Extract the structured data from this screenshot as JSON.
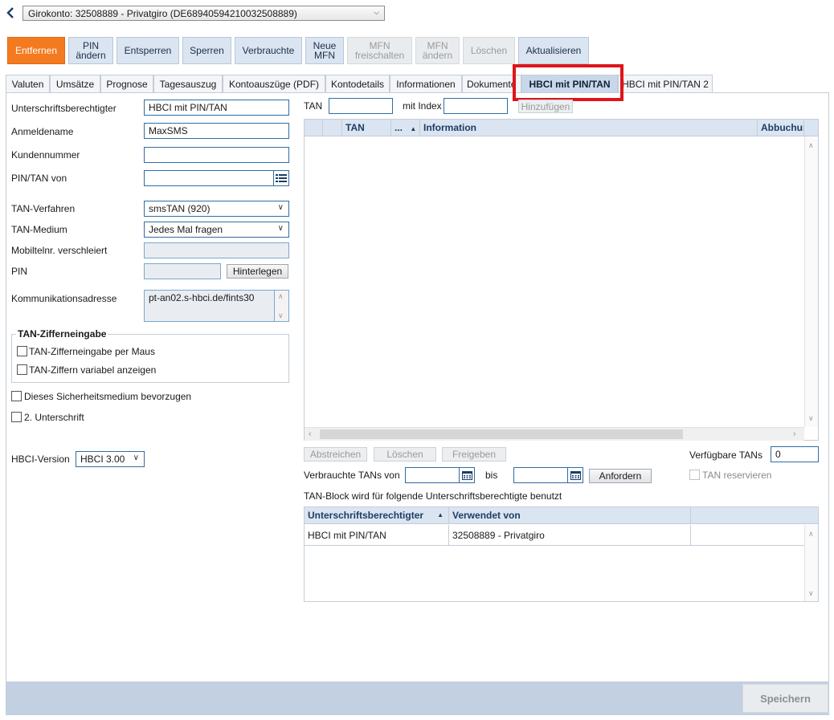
{
  "account": {
    "selector": "Girokonto: 32508889 - Privatgiro (DE68940594210032508889)"
  },
  "toolbar": {
    "remove": "Entfernen",
    "pin_change_1": "PIN",
    "pin_change_2": "ändern",
    "unlock": "Entsperren",
    "lock": "Sperren",
    "used": "Verbrauchte",
    "new_mfn_1": "Neue",
    "new_mfn_2": "MFN",
    "mfn_unlock_1": "MFN",
    "mfn_unlock_2": "freischalten",
    "mfn_change_1": "MFN",
    "mfn_change_2": "ändern",
    "delete": "Löschen",
    "refresh": "Aktualisieren"
  },
  "tabs": [
    "Valuten",
    "Umsätze",
    "Prognose",
    "Tagesauszug",
    "Kontoauszüge (PDF)",
    "Kontodetails",
    "Informationen",
    "Dokumente",
    "HBCI mit PIN/TAN",
    "HBCI mit PIN/TAN 2"
  ],
  "form": {
    "signatory_label": "Unterschriftsberechtigter",
    "signatory_value": "HBCI mit PIN/TAN",
    "login_label": "Anmeldename",
    "login_value": "MaxSMS",
    "customer_label": "Kundennummer",
    "customer_value": "",
    "pintan_from_label": "PIN/TAN von",
    "pintan_from_value": "",
    "tan_method_label": "TAN-Verfahren",
    "tan_method_value": "smsTAN (920)",
    "tan_medium_label": "TAN-Medium",
    "tan_medium_value": "Jedes Mal fragen",
    "mobile_label": "Mobiltelnr. verschleiert",
    "mobile_value": "",
    "pin_label": "PIN",
    "pin_button": "Hinterlegen",
    "comm_label": "Kommunikationsadresse",
    "comm_value": "pt-an02.s-hbci.de/fints30",
    "group_title": "TAN-Zifferneingabe",
    "chk_mouse": "TAN-Zifferneingabe per Maus",
    "chk_variable": "TAN-Ziffern variabel anzeigen",
    "chk_prefer": "Dieses Sicherheitsmedium bevorzugen",
    "chk_second": "2. Unterschrift",
    "hbci_version_label": "HBCI-Version",
    "hbci_version_value": "HBCI 3.00"
  },
  "tan": {
    "tan_label": "TAN",
    "index_label": "mit Index",
    "add_button": "Hinzufügen",
    "columns": [
      "TAN",
      "...",
      "Information",
      "Abbuchung"
    ],
    "strike_button": "Abstreichen",
    "delete_button": "Löschen",
    "release_button": "Freigeben",
    "available_label": "Verfügbare TANs",
    "available_value": "0",
    "used_from_label": "Verbrauchte TANs von",
    "to_label": "bis",
    "request_button": "Anfordern",
    "reserve_label": "TAN reservieren",
    "block_text": "TAN-Block wird für folgende Unterschriftsberechtigte benutzt"
  },
  "signatory_table": {
    "columns": [
      "Unterschriftsberechtigter",
      "Verwendet von"
    ],
    "rows": [
      {
        "signatory": "HBCI mit PIN/TAN",
        "used_by": "32508889 - Privatgiro"
      }
    ]
  },
  "footer": {
    "save": "Speichern"
  },
  "colors": {
    "accent": "#f47a20",
    "highlight": "#e0141a",
    "tab_active": "#c8d8ea"
  }
}
